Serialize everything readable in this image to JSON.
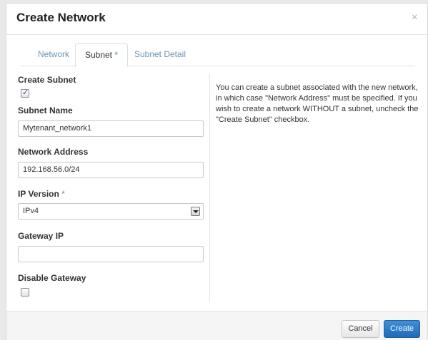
{
  "modal": {
    "title": "Create Network",
    "close_symbol": "×"
  },
  "tabs": [
    {
      "label": "Network",
      "required": "",
      "active": false
    },
    {
      "label": "Subnet",
      "required": "*",
      "active": true
    },
    {
      "label": "Subnet Detail",
      "required": "",
      "active": false
    }
  ],
  "form": {
    "create_subnet": {
      "label": "Create Subnet",
      "checked": true
    },
    "subnet_name": {
      "label": "Subnet Name",
      "value": "Mytenant_network1"
    },
    "network_address": {
      "label": "Network Address",
      "value": "192.168.56.0/24"
    },
    "ip_version": {
      "label": "IP Version",
      "required": "*",
      "selected": "IPv4"
    },
    "gateway_ip": {
      "label": "Gateway IP",
      "value": ""
    },
    "disable_gateway": {
      "label": "Disable Gateway",
      "checked": false
    }
  },
  "help": {
    "text": "You can create a subnet associated with the new network, in which case \"Network Address\" must be specified. If you wish to create a network WITHOUT a subnet, uncheck the \"Create Subnet\" checkbox."
  },
  "footer": {
    "cancel_label": "Cancel",
    "create_label": "Create"
  },
  "colors": {
    "primary": "#2a78c8",
    "tab_link": "#6e94b4"
  }
}
